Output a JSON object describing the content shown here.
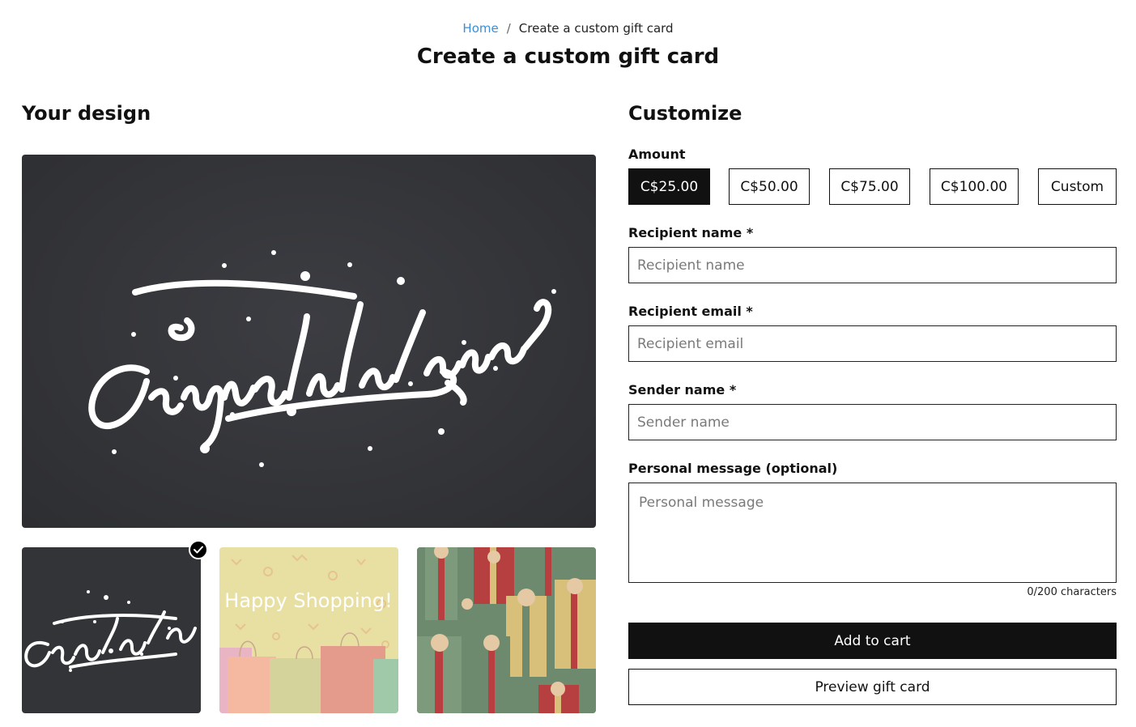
{
  "breadcrumb": {
    "home": "Home",
    "separator": "/",
    "current": "Create a custom gift card"
  },
  "page_title": "Create a custom gift card",
  "design": {
    "title": "Your design",
    "main_card_text": "Congratulations",
    "thumbnails": [
      {
        "name": "congratulations",
        "text": "Congratulations",
        "selected": true
      },
      {
        "name": "happy-shopping",
        "text": "Happy Shopping!",
        "selected": false
      },
      {
        "name": "gift-boxes",
        "text": "",
        "selected": false
      }
    ]
  },
  "customize": {
    "title": "Customize",
    "amount_label": "Amount",
    "amounts": [
      "C$25.00",
      "C$50.00",
      "C$75.00",
      "C$100.00",
      "Custom"
    ],
    "selected_amount": "C$25.00",
    "recipient_name": {
      "label": "Recipient name *",
      "placeholder": "Recipient name",
      "value": ""
    },
    "recipient_email": {
      "label": "Recipient email *",
      "placeholder": "Recipient email",
      "value": ""
    },
    "sender_name": {
      "label": "Sender name *",
      "placeholder": "Sender name",
      "value": ""
    },
    "message": {
      "label": "Personal message (optional)",
      "placeholder": "Personal message",
      "value": "",
      "counter": "0/200 characters"
    },
    "add_to_cart": "Add to cart",
    "preview": "Preview gift card"
  },
  "colors": {
    "accent_link": "#3a8fd8",
    "primary_button": "#111111",
    "card_background": "#333438"
  }
}
